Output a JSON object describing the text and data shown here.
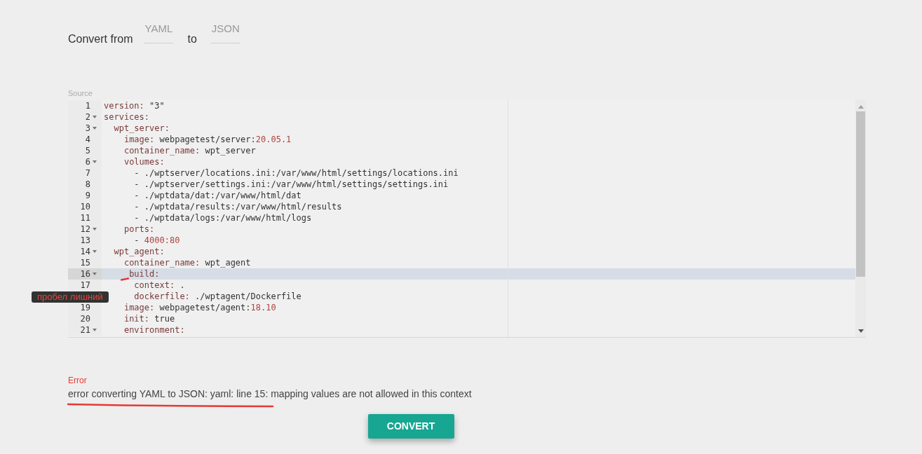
{
  "header": {
    "label_from": "Convert from",
    "from_format": "YAML",
    "label_to": "to",
    "to_format": "JSON"
  },
  "source": {
    "label": "Source",
    "lines": [
      {
        "number": "1",
        "fold": false,
        "active": false,
        "tokens": [
          {
            "kind": "key",
            "text": "version:"
          },
          {
            "kind": "text",
            "text": " \"3\""
          }
        ]
      },
      {
        "number": "2",
        "fold": true,
        "active": false,
        "tokens": [
          {
            "kind": "key",
            "text": "services:"
          }
        ]
      },
      {
        "number": "3",
        "fold": true,
        "active": false,
        "tokens": [
          {
            "kind": "key",
            "text": "  wpt_server:"
          }
        ]
      },
      {
        "number": "4",
        "fold": false,
        "active": false,
        "tokens": [
          {
            "kind": "key",
            "text": "    image:"
          },
          {
            "kind": "text",
            "text": " webpagetest/server:"
          },
          {
            "kind": "number",
            "text": "20.05.1"
          }
        ]
      },
      {
        "number": "5",
        "fold": false,
        "active": false,
        "tokens": [
          {
            "kind": "key",
            "text": "    container_name:"
          },
          {
            "kind": "text",
            "text": " wpt_server"
          }
        ]
      },
      {
        "number": "6",
        "fold": true,
        "active": false,
        "tokens": [
          {
            "kind": "key",
            "text": "    volumes:"
          }
        ]
      },
      {
        "number": "7",
        "fold": false,
        "active": false,
        "tokens": [
          {
            "kind": "text",
            "text": "      - ./wptserver/locations.ini:/var/www/html/settings/locations.ini"
          }
        ]
      },
      {
        "number": "8",
        "fold": false,
        "active": false,
        "tokens": [
          {
            "kind": "text",
            "text": "      - ./wptserver/settings.ini:/var/www/html/settings/settings.ini"
          }
        ]
      },
      {
        "number": "9",
        "fold": false,
        "active": false,
        "tokens": [
          {
            "kind": "text",
            "text": "      - ./wptdata/dat:/var/www/html/dat"
          }
        ]
      },
      {
        "number": "10",
        "fold": false,
        "active": false,
        "tokens": [
          {
            "kind": "text",
            "text": "      - ./wptdata/results:/var/www/html/results"
          }
        ]
      },
      {
        "number": "11",
        "fold": false,
        "active": false,
        "tokens": [
          {
            "kind": "text",
            "text": "      - ./wptdata/logs:/var/www/html/logs"
          }
        ]
      },
      {
        "number": "12",
        "fold": true,
        "active": false,
        "tokens": [
          {
            "kind": "key",
            "text": "    ports:"
          }
        ]
      },
      {
        "number": "13",
        "fold": false,
        "active": false,
        "tokens": [
          {
            "kind": "text",
            "text": "      - "
          },
          {
            "kind": "number",
            "text": "4000:80"
          }
        ]
      },
      {
        "number": "14",
        "fold": true,
        "active": false,
        "tokens": [
          {
            "kind": "key",
            "text": "  wpt_agent:"
          }
        ]
      },
      {
        "number": "15",
        "fold": false,
        "active": false,
        "tokens": [
          {
            "kind": "key",
            "text": "    container_name:"
          },
          {
            "kind": "text",
            "text": " wpt_agent"
          }
        ]
      },
      {
        "number": "16",
        "fold": true,
        "active": true,
        "tokens": [
          {
            "kind": "key",
            "text": "     build:"
          }
        ]
      },
      {
        "number": "17",
        "fold": false,
        "active": false,
        "tokens": [
          {
            "kind": "key",
            "text": "      context:"
          },
          {
            "kind": "text",
            "text": " ."
          }
        ]
      },
      {
        "fold": false,
        "active": false,
        "tokens": [
          {
            "kind": "key",
            "text": "      dockerfile:"
          },
          {
            "kind": "text",
            "text": " ./wptagent/Dockerfile"
          }
        ]
      },
      {
        "number": "19",
        "fold": false,
        "active": false,
        "tokens": [
          {
            "kind": "key",
            "text": "    image:"
          },
          {
            "kind": "text",
            "text": " webpagetest/agent:"
          },
          {
            "kind": "number",
            "text": "18.10"
          }
        ]
      },
      {
        "number": "20",
        "fold": false,
        "active": false,
        "tokens": [
          {
            "kind": "key",
            "text": "    init:"
          },
          {
            "kind": "text",
            "text": " true"
          }
        ]
      },
      {
        "number": "21",
        "fold": true,
        "active": false,
        "tokens": [
          {
            "kind": "key",
            "text": "    environment:"
          }
        ]
      }
    ]
  },
  "annotation": {
    "note": "пробел лишний"
  },
  "error": {
    "label": "Error",
    "message": "error converting YAML to JSON: yaml: line 15: mapping values are not allowed in this context"
  },
  "convert_button": "CONVERT"
}
